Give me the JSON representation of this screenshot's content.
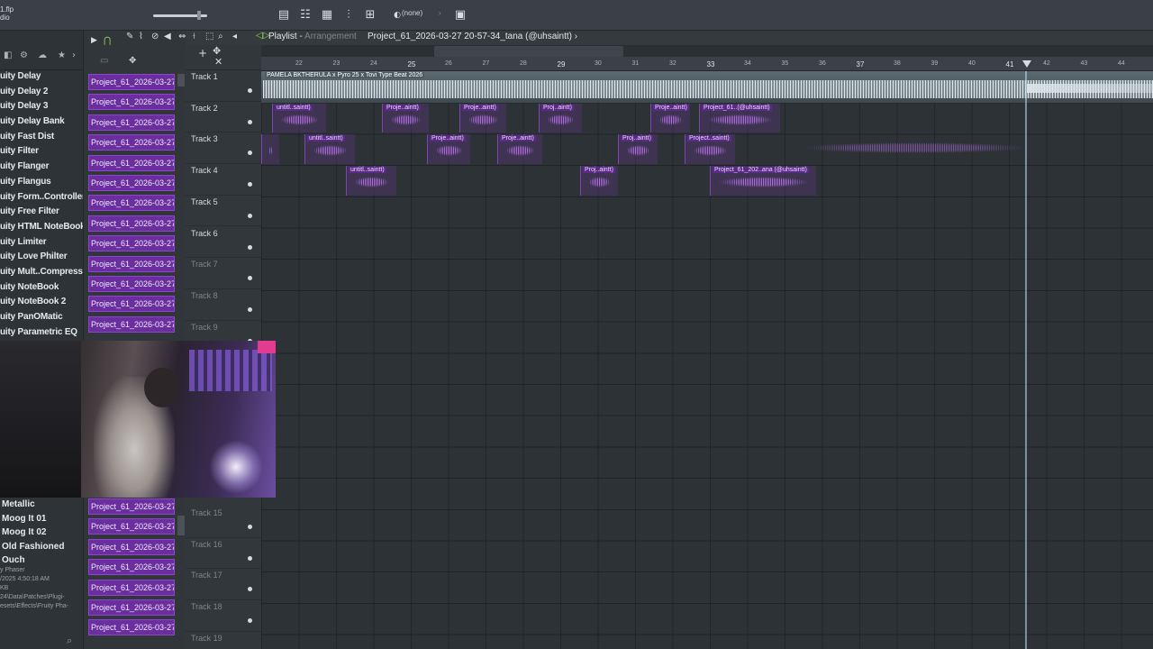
{
  "app": {
    "corner_text": [
      "1.flp",
      "dio"
    ]
  },
  "toolbar": {
    "pattern_selector": "(none)",
    "icons": [
      "playlist-icon",
      "piano-roll-icon",
      "channel-rack-icon",
      "mixer-icon",
      "browser-icon",
      "plugin-picker-icon"
    ]
  },
  "playlist": {
    "title": "Playlist",
    "subtitle": "Arrangement",
    "project": "Project_61_2026-03-27 20-57-34_tana (@uhsaintt)",
    "project_arrow": "›"
  },
  "browser": {
    "plugins": [
      "uity Delay",
      "uity Delay 2",
      "uity Delay 3",
      "uity Delay Bank",
      "uity Fast Dist",
      "uity Filter",
      "uity Flanger",
      "uity Flangus",
      "uity Form..Controller",
      "uity Free Filter",
      "uity HTML NoteBook",
      "uity Limiter",
      "uity Love Philter",
      "uity Mult..Compressor",
      "uity NoteBook",
      "uity NoteBook 2",
      "uity PanOMatic",
      "uity Parametric EQ"
    ],
    "plugins_lower": [
      "Metallic",
      "Moog It 01",
      "Moog It 02",
      "Old Fashioned",
      "Ouch"
    ],
    "file_info": [
      "y Phaser",
      "/2025 4:50:18 AM",
      "KB",
      "24\\Data\\Patches\\Plugi-",
      "esets\\Effects\\Fruity Pha-"
    ]
  },
  "clips": {
    "label": "Project_61_2026-03-27...",
    "upper_count": 13,
    "lower_count": 7
  },
  "tracks": [
    {
      "name": "Track 1",
      "dim": false
    },
    {
      "name": "Track 2",
      "dim": false
    },
    {
      "name": "Track 3",
      "dim": false
    },
    {
      "name": "Track 4",
      "dim": false
    },
    {
      "name": "Track 5",
      "dim": false
    },
    {
      "name": "Track 6",
      "dim": false
    },
    {
      "name": "Track 7",
      "dim": true
    },
    {
      "name": "Track 8",
      "dim": true
    },
    {
      "name": "Track 9",
      "dim": true
    }
  ],
  "tracks_lower": [
    {
      "name": "Track 15"
    },
    {
      "name": "Track 16"
    },
    {
      "name": "Track 17"
    },
    {
      "name": "Track 18"
    },
    {
      "name": "Track 19"
    }
  ],
  "timeline": {
    "bars": [
      "22",
      "23",
      "24",
      "25",
      "26",
      "27",
      "28",
      "29",
      "30",
      "31",
      "32",
      "33",
      "34",
      "35",
      "36",
      "37",
      "38",
      "39",
      "40",
      "41",
      "42",
      "43",
      "44"
    ],
    "major_bars": [
      "25",
      "29",
      "33",
      "37",
      "41"
    ]
  },
  "beat_clip": {
    "label": "PAMELA BKTHERULA x Pyro 25 x Tovi Type Beat 2026"
  },
  "audio_clips": [
    {
      "track": 2,
      "label": "untitl..saintt)"
    },
    {
      "track": 2,
      "label": "Proje..aintt)"
    },
    {
      "track": 2,
      "label": "Proje..aintt)"
    },
    {
      "track": 2,
      "label": "Proj..aintt)"
    },
    {
      "track": 2,
      "label": "Proje..aintt)"
    },
    {
      "track": 2,
      "label": "Project_61..(@uhsaintt)"
    },
    {
      "track": 3,
      "label": ""
    },
    {
      "track": 3,
      "label": "untitl..saintt)"
    },
    {
      "track": 3,
      "label": "Proje..aintt)"
    },
    {
      "track": 3,
      "label": "Proje..aintt)"
    },
    {
      "track": 3,
      "label": "Proj..aintt)"
    },
    {
      "track": 3,
      "label": "Project..saintt)"
    },
    {
      "track": 4,
      "label": "untitl..saintt)"
    },
    {
      "track": 4,
      "label": "Proj..aintt)"
    },
    {
      "track": 4,
      "label": "Project_61_202..ana (@uhsaintt)"
    }
  ]
}
